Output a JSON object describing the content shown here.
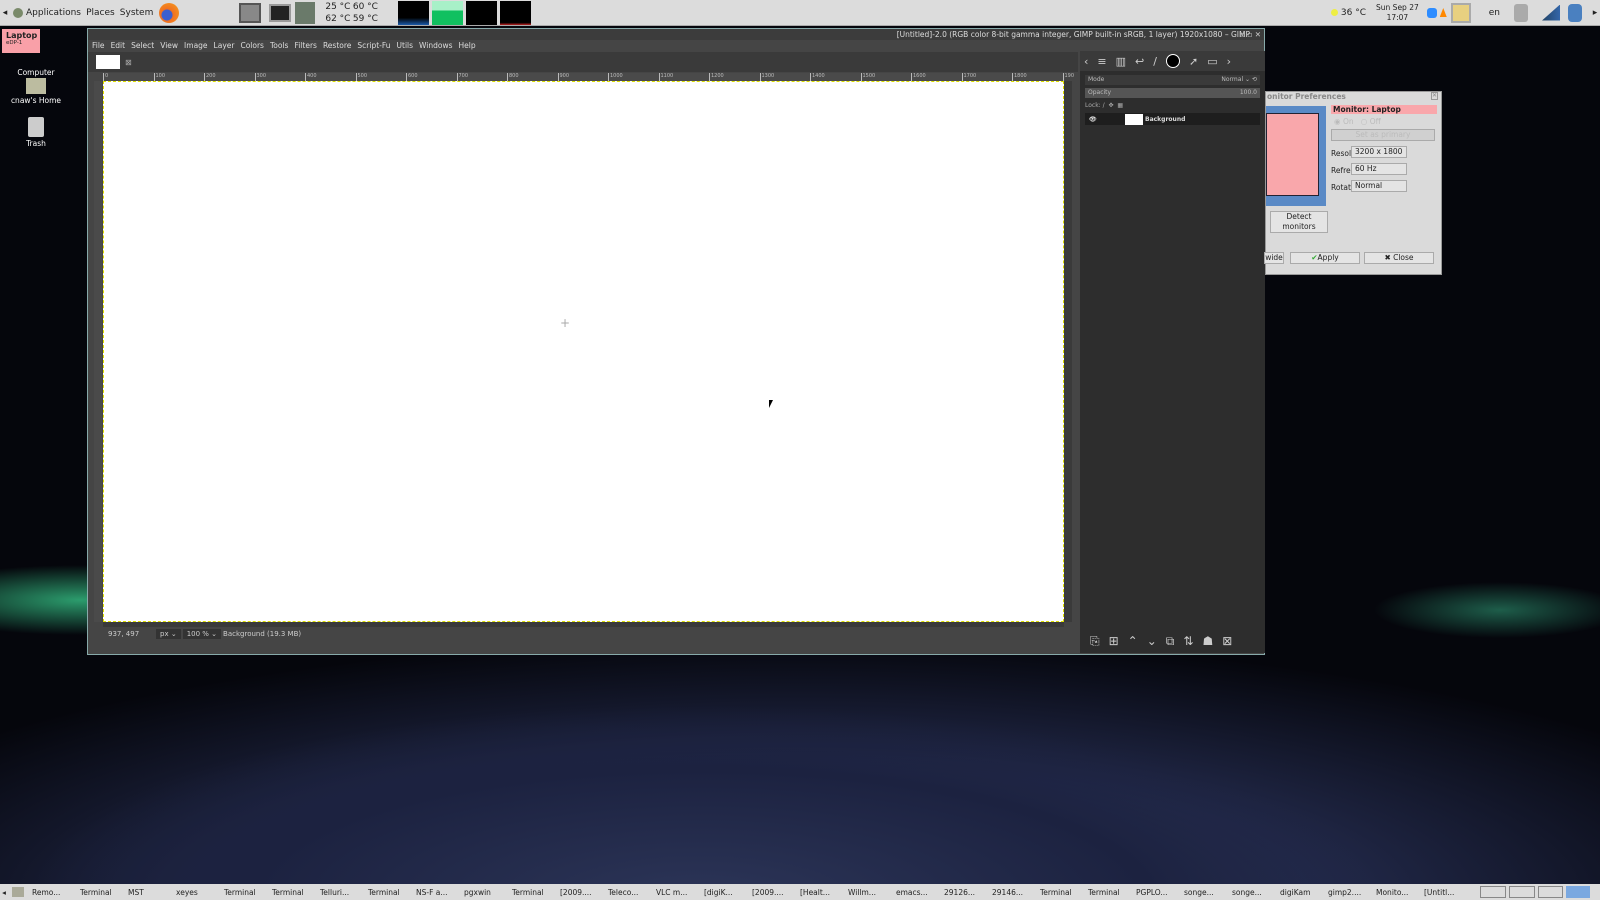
{
  "top_panel": {
    "menus": [
      "Applications",
      "Places",
      "System"
    ],
    "temps": [
      "25 °C",
      "60 °C",
      "62 °C",
      "59 °C"
    ],
    "weather": "36 °C",
    "date": "Sun Sep 27",
    "time": "17:07",
    "lang": "en"
  },
  "desktop": {
    "osd_title": "Laptop",
    "osd_sub": "eDP-1",
    "icons": [
      "Computer",
      "cnaw's Home",
      "Trash"
    ]
  },
  "gimp": {
    "title": "[Untitled]-2.0 (RGB color 8-bit gamma integer, GIMP built-in sRGB, 1 layer) 1920x1080 – GIMP",
    "menu": [
      "File",
      "Edit",
      "Select",
      "View",
      "Image",
      "Layer",
      "Colors",
      "Tools",
      "Filters",
      "Restore",
      "Script-Fu",
      "Utils",
      "Windows",
      "Help"
    ],
    "ruler": [
      "0",
      "100",
      "200",
      "300",
      "400",
      "500",
      "600",
      "700",
      "800",
      "900",
      "1000",
      "1100",
      "1200",
      "1300",
      "1400",
      "1500",
      "1600",
      "1700",
      "1800",
      "190"
    ],
    "status": {
      "coords": "937, 497",
      "unit": "px",
      "zoom": "100 %",
      "info": "Background (19.3 MB)"
    },
    "layers": {
      "mode_label": "Mode",
      "mode": "Normal",
      "opacity_label": "Opacity",
      "opacity": "100.0",
      "lock_label": "Lock:",
      "layer": "Background"
    }
  },
  "monitor_dialog": {
    "title": "onitor Preferences",
    "monitor": "Monitor: Laptop",
    "on": "On",
    "off": "Off",
    "set_primary": "Set as primary",
    "resolution_label": "Resolution:",
    "resolution": "3200 x 1800",
    "refresh_label": "Refresh rate:",
    "refresh": "60 Hz",
    "rotation_label": "Rotation:",
    "rotation": "Normal",
    "detect": "Detect monitors",
    "wide": "wide",
    "apply": "Apply",
    "close": "Close"
  },
  "taskbar": [
    "Remo...",
    "Terminal",
    "MST",
    "xeyes",
    "Terminal",
    "Terminal",
    "Telluri...",
    "Terminal",
    "NS-F a...",
    "pgxwin",
    "Terminal",
    "[2009....",
    "Teleco...",
    "VLC m...",
    "[digiK...",
    "[2009....",
    "[Healt...",
    "Willm...",
    "emacs...",
    "29126...",
    "29146...",
    "Terminal",
    "Terminal",
    "PGPLO...",
    "songe...",
    "songe...",
    "digiKam",
    "gimp2....",
    "Monito...",
    "[Untitl..."
  ]
}
